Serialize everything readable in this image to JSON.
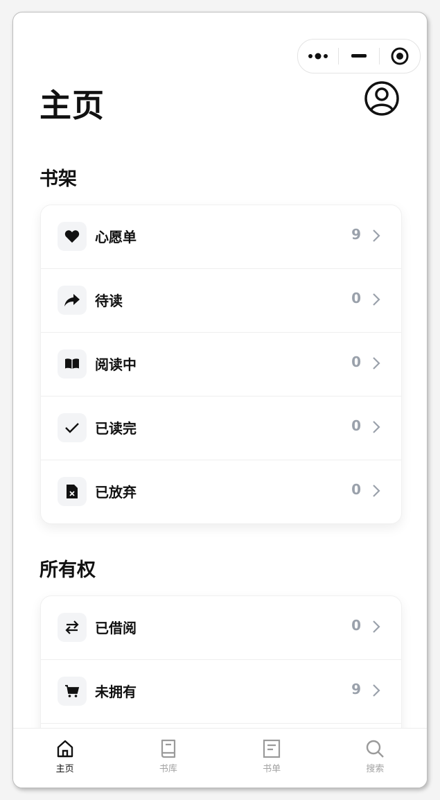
{
  "header": {
    "title": "主页"
  },
  "shelf": {
    "title": "书架",
    "items": [
      {
        "icon": "heart-icon",
        "label": "心愿单",
        "count": "9"
      },
      {
        "icon": "share-arrow-icon",
        "label": "待读",
        "count": "0"
      },
      {
        "icon": "open-book-icon",
        "label": "阅读中",
        "count": "0"
      },
      {
        "icon": "checkmark-icon",
        "label": "已读完",
        "count": "0"
      },
      {
        "icon": "file-x-icon",
        "label": "已放弃",
        "count": "0"
      }
    ]
  },
  "ownership": {
    "title": "所有权",
    "items": [
      {
        "icon": "swap-arrows-icon",
        "label": "已借阅",
        "count": "0"
      },
      {
        "icon": "cart-icon",
        "label": "未拥有",
        "count": "9"
      }
    ]
  },
  "tabbar": {
    "tabs": [
      {
        "icon": "home-icon",
        "label": "主页",
        "active": true
      },
      {
        "icon": "book-icon",
        "label": "书库",
        "active": false
      },
      {
        "icon": "list-icon",
        "label": "书单",
        "active": false
      },
      {
        "icon": "search-icon",
        "label": "搜索",
        "active": false
      }
    ]
  }
}
